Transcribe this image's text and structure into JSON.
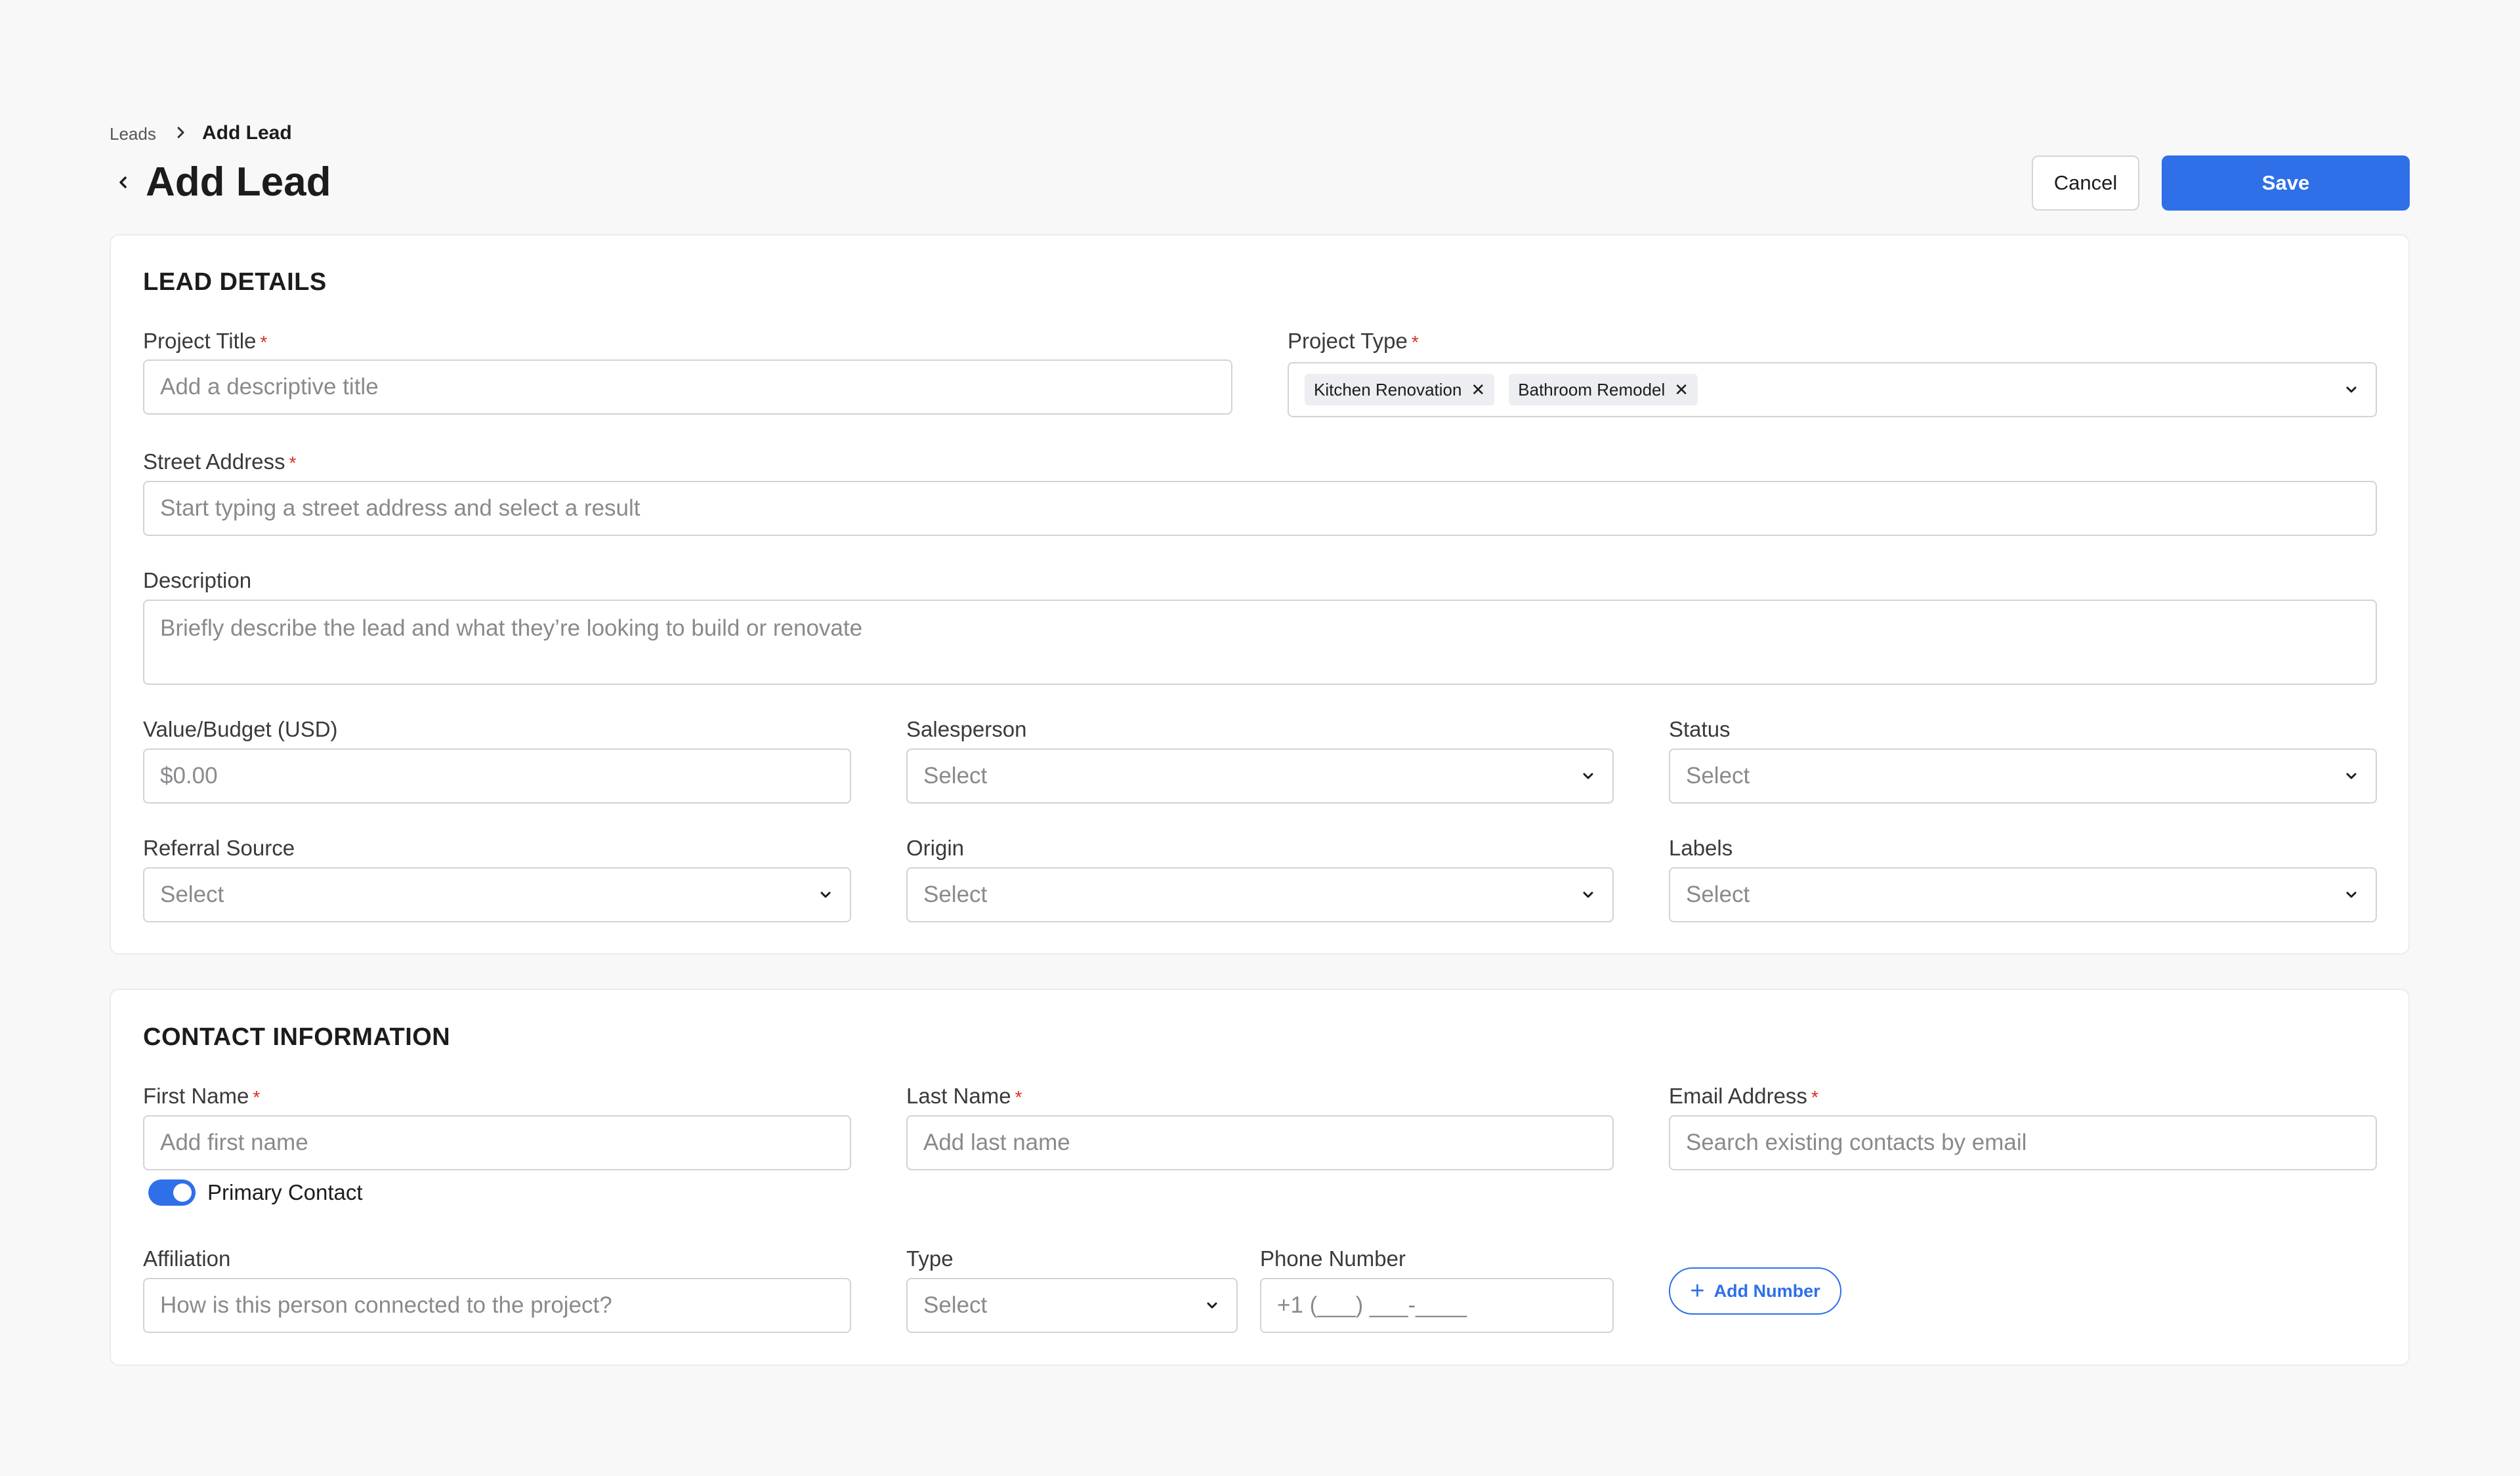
{
  "breadcrumb": {
    "parent": "Leads",
    "current": "Add Lead"
  },
  "header": {
    "title": "Add Lead",
    "cancel_label": "Cancel",
    "save_label": "Save"
  },
  "lead_details": {
    "section_title": "LEAD DETAILS",
    "project_title": {
      "label": "Project Title",
      "placeholder": "Add a descriptive title",
      "value": ""
    },
    "project_type": {
      "label": "Project Type",
      "selected": [
        "Kitchen Renovation",
        "Bathroom Remodel"
      ]
    },
    "street_address": {
      "label": "Street Address",
      "placeholder": "Start typing a street address and select a result",
      "value": ""
    },
    "description": {
      "label": "Description",
      "placeholder": "Briefly describe the lead and what they’re looking to build or renovate",
      "value": ""
    },
    "value_budget": {
      "label": "Value/Budget (USD)",
      "placeholder": "$0.00",
      "value": ""
    },
    "salesperson": {
      "label": "Salesperson",
      "value": "Select"
    },
    "status": {
      "label": "Status",
      "value": "Select"
    },
    "referral_source": {
      "label": "Referral Source",
      "value": "Select"
    },
    "origin": {
      "label": "Origin",
      "value": "Select"
    },
    "labels": {
      "label": "Labels",
      "value": "Select"
    }
  },
  "contact_information": {
    "section_title": "CONTACT INFORMATION",
    "first_name": {
      "label": "First Name",
      "placeholder": "Add first name",
      "value": ""
    },
    "last_name": {
      "label": "Last Name",
      "placeholder": "Add last name",
      "value": ""
    },
    "email": {
      "label": "Email Address",
      "placeholder": "Search existing contacts by email",
      "value": ""
    },
    "primary_contact": {
      "label": "Primary Contact",
      "enabled": true
    },
    "affiliation": {
      "label": "Affiliation",
      "placeholder": "How is this person connected to the project?",
      "value": ""
    },
    "phone_type": {
      "label": "Type",
      "value": "Select"
    },
    "phone_number": {
      "label": "Phone Number",
      "placeholder": "+1 (___) ___-____",
      "value": ""
    },
    "add_number_label": "Add Number"
  },
  "icons": {
    "breadcrumb_separator": "chevron-right-icon",
    "back": "chevron-left-icon",
    "dropdown": "chevron-down-icon",
    "remove_chip": "close-icon",
    "add": "plus-icon"
  },
  "colors": {
    "primary": "#2f6fe8",
    "required": "#d92d20",
    "background": "#f8f8f8",
    "card": "#ffffff",
    "chip_bg": "#eceef2"
  }
}
